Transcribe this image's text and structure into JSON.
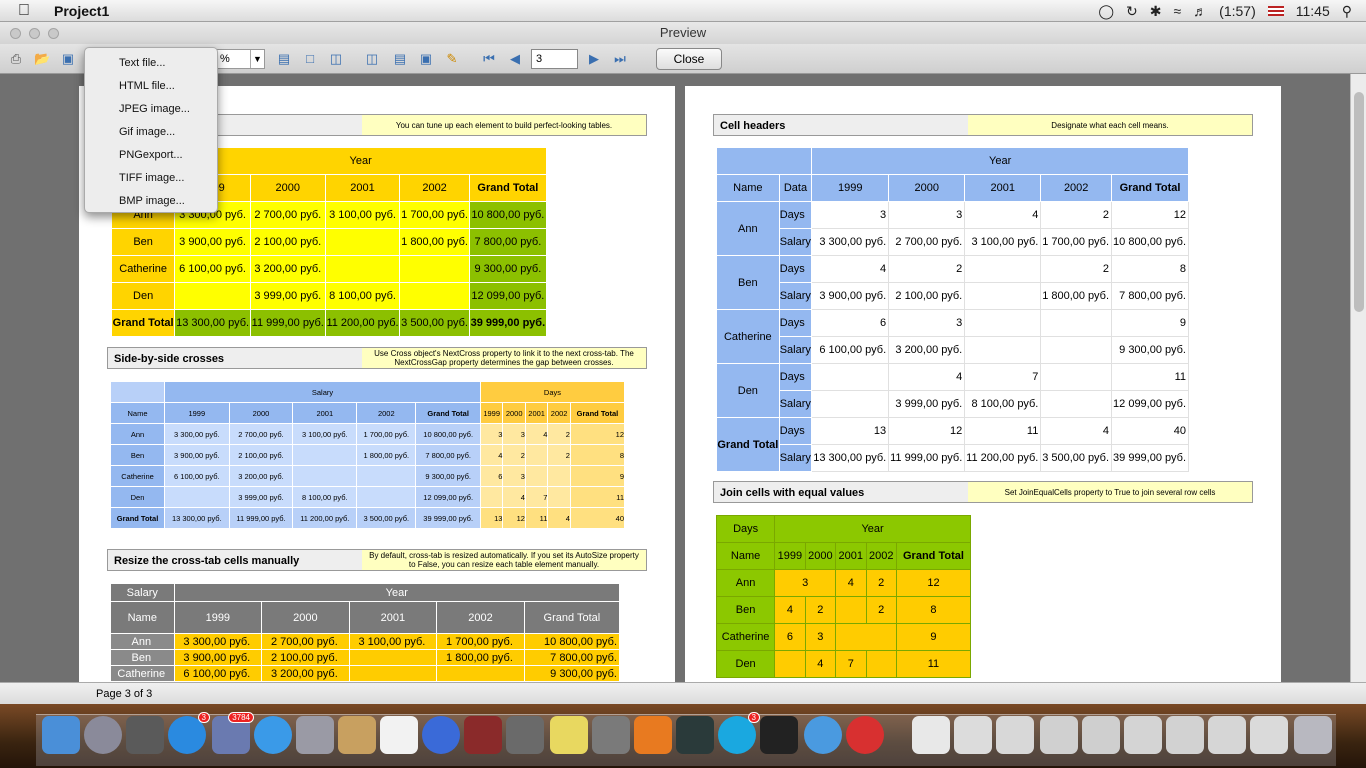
{
  "app": {
    "name": "Project1",
    "window_title": "Preview"
  },
  "tray": {
    "battery": "(1:57)",
    "clock": "11:45"
  },
  "toolbar": {
    "zoom_value": "%",
    "page_value": "3",
    "close_label": "Close"
  },
  "export_menu": [
    "Text file...",
    "HTML file...",
    "JPEG image...",
    "Gif image...",
    "PNGexport...",
    "TIFF image...",
    "BMP image..."
  ],
  "status": {
    "page_text": "Page 3 of 3"
  },
  "left": {
    "sec1_desc": "You can tune up each element to build perfect-looking tables.",
    "t1": {
      "year": "Year",
      "headers": [
        "1999",
        "2000",
        "2001",
        "2002",
        "Grand Total"
      ],
      "rows": [
        [
          "Ann",
          "3 300,00 руб.",
          "2 700,00 руб.",
          "3 100,00 руб.",
          "1 700,00 руб.",
          "10 800,00 руб."
        ],
        [
          "Ben",
          "3 900,00 руб.",
          "2 100,00 руб.",
          "",
          "1 800,00 руб.",
          "7 800,00 руб."
        ],
        [
          "Catherine",
          "6 100,00 руб.",
          "3 200,00 руб.",
          "",
          "",
          "9 300,00 руб."
        ],
        [
          "Den",
          "",
          "3 999,00 руб.",
          "8 100,00 руб.",
          "",
          "12 099,00 руб."
        ],
        [
          "Grand Total",
          "13 300,00 руб.",
          "11 999,00 руб.",
          "11 200,00 руб.",
          "3 500,00 руб.",
          "39 999,00 руб."
        ]
      ]
    },
    "sec2_title": "Side-by-side crosses",
    "sec2_desc": "Use Cross object's NextCross property to link it to the next cross-tab. The NextCrossGap property determines the gap between crosses.",
    "t2": {
      "salary": "Salary",
      "days": "Days",
      "h": [
        "Name",
        "1999",
        "2000",
        "2001",
        "2002",
        "Grand Total",
        "1999",
        "2000",
        "2001",
        "2002",
        "Grand Total"
      ],
      "rows": [
        [
          "Ann",
          "3 300,00 руб.",
          "2 700,00 руб.",
          "3 100,00 руб.",
          "1 700,00 руб.",
          "10 800,00 руб.",
          "3",
          "3",
          "4",
          "2",
          "12"
        ],
        [
          "Ben",
          "3 900,00 руб.",
          "2 100,00 руб.",
          "",
          "1 800,00 руб.",
          "7 800,00 руб.",
          "4",
          "2",
          "",
          "2",
          "8"
        ],
        [
          "Catherine",
          "6 100,00 руб.",
          "3 200,00 руб.",
          "",
          "",
          "9 300,00 руб.",
          "6",
          "3",
          "",
          "",
          "9"
        ],
        [
          "Den",
          "",
          "3 999,00 руб.",
          "8 100,00 руб.",
          "",
          "12 099,00 руб.",
          "",
          "4",
          "7",
          "",
          "11"
        ],
        [
          "Grand Total",
          "13 300,00 руб.",
          "11 999,00 руб.",
          "11 200,00 руб.",
          "3 500,00 руб.",
          "39 999,00 руб.",
          "13",
          "12",
          "11",
          "4",
          "40"
        ]
      ]
    },
    "sec3_title": "Resize the cross-tab cells manually",
    "sec3_desc": "By default, cross-tab is resized automatically. If you set its AutoSize property to False, you can resize each table element manually.",
    "t3": {
      "salary": "Salary",
      "year": "Year",
      "h": [
        "Name",
        "1999",
        "2000",
        "2001",
        "2002",
        "Grand Total"
      ],
      "rows": [
        [
          "Ann",
          "3 300,00 руб.",
          "2 700,00 руб.",
          "3 100,00 руб.",
          "1 700,00 руб.",
          "10 800,00 руб."
        ],
        [
          "Ben",
          "3 900,00 руб.",
          "2 100,00 руб.",
          "",
          "1 800,00 руб.",
          "7 800,00 руб."
        ],
        [
          "Catherine",
          "6 100,00 руб.",
          "3 200,00 руб.",
          "",
          "",
          "9 300,00 руб."
        ]
      ]
    }
  },
  "right": {
    "sec1_title": "Cell headers",
    "sec1_desc": "Designate what each cell means.",
    "t4": {
      "year": "Year",
      "h": [
        "Name",
        "Data",
        "1999",
        "2000",
        "2001",
        "2002",
        "Grand Total"
      ],
      "names": [
        "Ann",
        "Ben",
        "Catherine",
        "Den",
        "Grand Total"
      ],
      "labels": [
        "Days",
        "Salary"
      ],
      "rows": [
        [
          "3",
          "3",
          "4",
          "2",
          "12"
        ],
        [
          "3 300,00 руб.",
          "2 700,00 руб.",
          "3 100,00 руб.",
          "1 700,00 руб.",
          "10 800,00 руб."
        ],
        [
          "4",
          "2",
          "",
          "2",
          "8"
        ],
        [
          "3 900,00 руб.",
          "2 100,00 руб.",
          "",
          "1 800,00 руб.",
          "7 800,00 руб."
        ],
        [
          "6",
          "3",
          "",
          "",
          "9"
        ],
        [
          "6 100,00 руб.",
          "3 200,00 руб.",
          "",
          "",
          "9 300,00 руб."
        ],
        [
          "",
          "4",
          "7",
          "",
          "11"
        ],
        [
          "",
          "3 999,00 руб.",
          "8 100,00 руб.",
          "",
          "12 099,00 руб."
        ],
        [
          "13",
          "12",
          "11",
          "4",
          "40"
        ],
        [
          "13 300,00 руб.",
          "11 999,00 руб.",
          "11 200,00 руб.",
          "3 500,00 руб.",
          "39 999,00 руб."
        ]
      ]
    },
    "sec2_title": "Join cells with equal values",
    "sec2_desc": "Set JoinEqualCells property to True to join several row cells",
    "t5": {
      "days": "Days",
      "year": "Year",
      "h": [
        "Name",
        "1999",
        "2000",
        "2001",
        "2002",
        "Grand Total"
      ],
      "rows": [
        [
          "Ann",
          "3",
          "4",
          "2",
          "12"
        ],
        [
          "Ben",
          "4",
          "2",
          "",
          "2",
          "8"
        ],
        [
          "Catherine",
          "6",
          "3",
          "9"
        ],
        [
          "Den",
          "",
          "4",
          "7",
          "",
          "11"
        ]
      ]
    }
  },
  "dock_badges": {
    "appstore": "3",
    "mail": "3784",
    "skype": "3"
  }
}
